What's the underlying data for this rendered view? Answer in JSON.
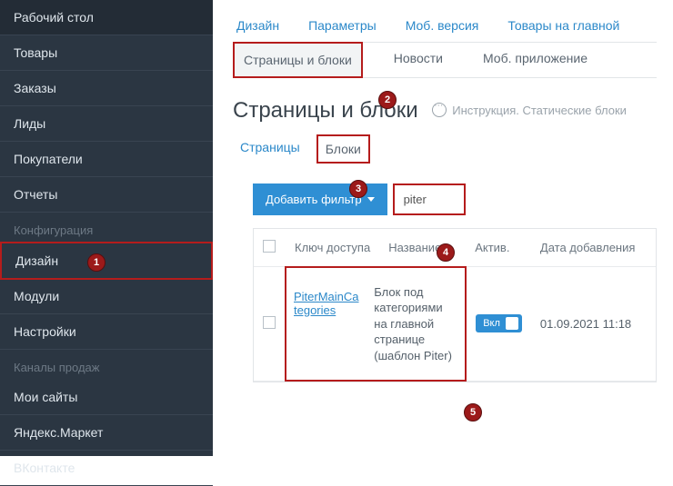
{
  "sidebar": {
    "main": [
      "Рабочий стол",
      "Товары",
      "Заказы",
      "Лиды",
      "Покупатели",
      "Отчеты"
    ],
    "section_config": "Конфигурация",
    "config": [
      "Дизайн",
      "Модули",
      "Настройки"
    ],
    "section_channels": "Каналы продаж",
    "channels": [
      "Мои сайты",
      "Яндекс.Маркет",
      "ВКонтакте"
    ]
  },
  "tabs_row1": [
    "Дизайн",
    "Параметры",
    "Моб. версия",
    "Товары на главной"
  ],
  "tabs_row2": [
    "Страницы и блоки",
    "Новости",
    "Моб. приложение"
  ],
  "page_title": "Страницы и блоки",
  "instruction": "Инструкция. Статические блоки",
  "subtabs": [
    "Страницы",
    "Блоки"
  ],
  "toolbar": {
    "add_filter": "Добавить фильтр",
    "search": "piter"
  },
  "columns": {
    "key": "Ключ доступа",
    "name": "Название",
    "active": "Актив.",
    "date": "Дата добавления"
  },
  "row": {
    "key": "PiterMainCategories",
    "name": "Блок под категориями на главной странице (шаблон Piter)",
    "active": "Вкл",
    "date": "01.09.2021 11:18"
  },
  "badges": [
    "1",
    "2",
    "3",
    "4",
    "5"
  ]
}
